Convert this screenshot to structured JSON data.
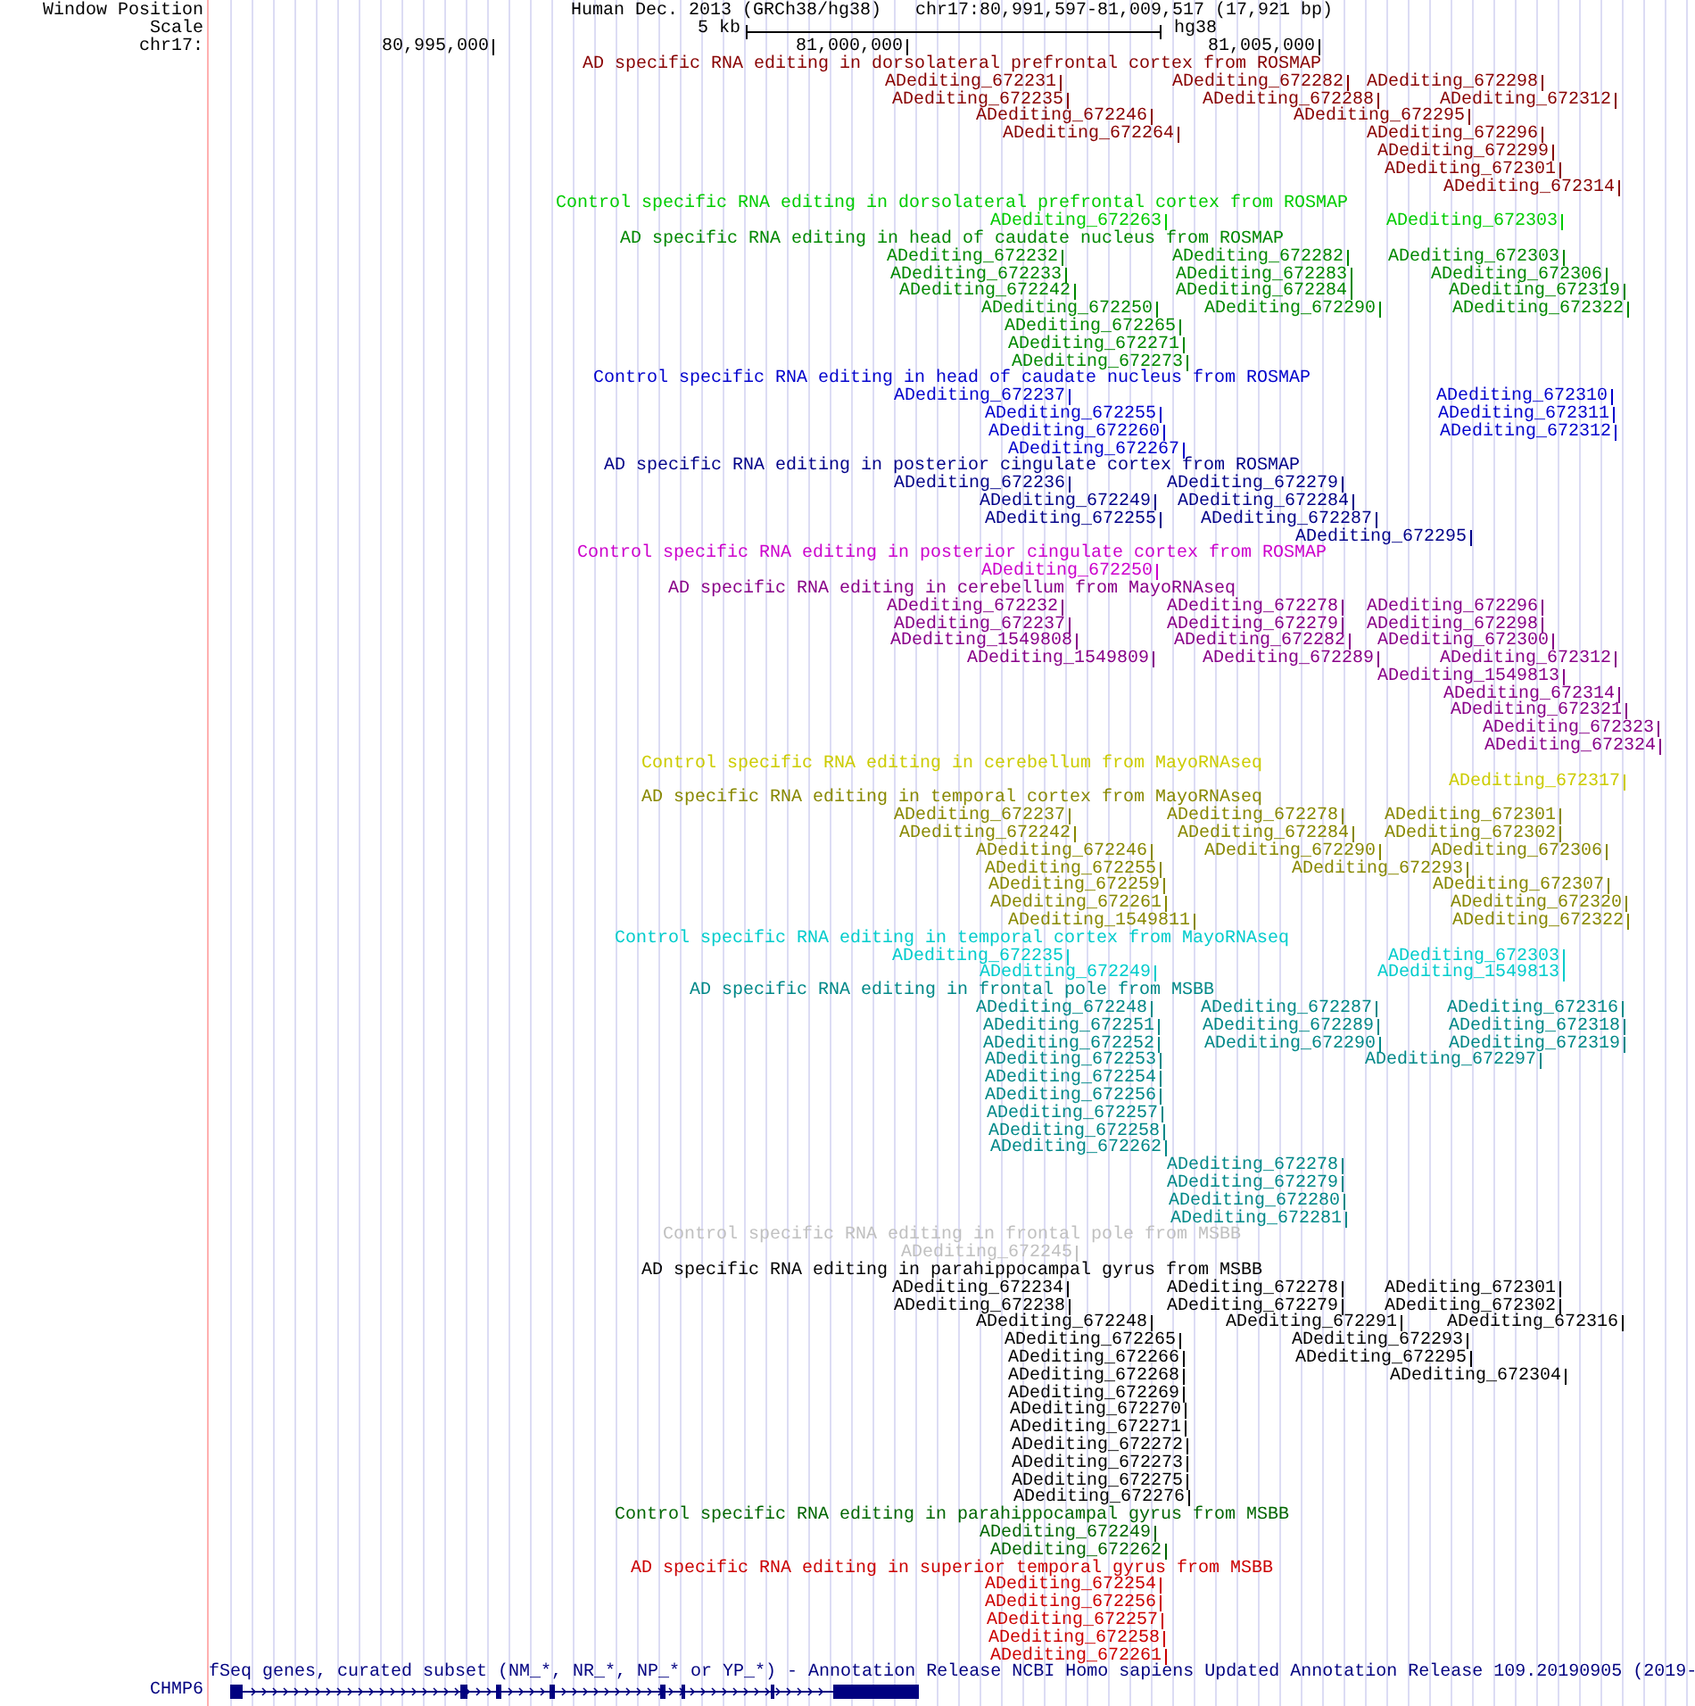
{
  "header": {
    "position_label": "Window Position",
    "assembly": "Human Dec. 2013 (GRCh38/hg38)",
    "region": "chr17:80,991,597-81,009,517 (17,921 bp)",
    "scale_label": "Scale",
    "scale_length": "5 kb",
    "scale_assembly": "hg38",
    "chrom_label": "chr17:",
    "ticks": [
      "80,995,000",
      "81,000,000",
      "81,005,000"
    ]
  },
  "tracks": [
    {
      "title": "AD specific RNA editing in dorsolateral prefrontal cortex from ROSMAP",
      "color": "#880000",
      "rows": [
        [
          "ADediting_672231",
          "ADediting_672282",
          "ADediting_672298"
        ],
        [
          "ADediting_672235",
          "ADediting_672288",
          "ADediting_672312"
        ],
        [
          "ADediting_672246",
          "ADediting_672295"
        ],
        [
          "ADediting_672264",
          "ADediting_672296"
        ],
        [
          "ADediting_672299"
        ],
        [
          "ADediting_672301"
        ],
        [
          "ADediting_672314"
        ]
      ]
    },
    {
      "title": "Control specific RNA editing in dorsolateral prefrontal cortex from ROSMAP",
      "color": "#00cc00",
      "rows": [
        [
          "ADediting_672263",
          "ADediting_672303"
        ]
      ]
    },
    {
      "title": "AD specific RNA editing in head of caudate nucleus from ROSMAP",
      "color": "#008800",
      "rows": [
        [
          "ADediting_672232",
          "ADediting_672282",
          "ADediting_672303"
        ],
        [
          "ADediting_672233",
          "ADediting_672283",
          "ADediting_672306"
        ],
        [
          "ADediting_672242",
          "ADediting_672284",
          "ADediting_672319"
        ],
        [
          "ADediting_672250",
          "ADediting_672290",
          "ADediting_672322"
        ],
        [
          "ADediting_672265"
        ],
        [
          "ADediting_672271"
        ],
        [
          "ADediting_672273"
        ]
      ]
    },
    {
      "title": "Control specific RNA editing in head of caudate nucleus from ROSMAP",
      "color": "#0000cc",
      "rows": [
        [
          "ADediting_672237",
          "ADediting_672310"
        ],
        [
          "ADediting_672255",
          "ADediting_672311"
        ],
        [
          "ADediting_672260",
          "ADediting_672312"
        ],
        [
          "ADediting_672267"
        ]
      ]
    },
    {
      "title": "AD specific RNA editing in posterior cingulate cortex from ROSMAP",
      "color": "#000088",
      "rows": [
        [
          "ADediting_672236",
          "ADediting_672279"
        ],
        [
          "ADediting_672249",
          "ADediting_672284"
        ],
        [
          "ADediting_672255",
          "ADediting_672287"
        ],
        [
          "ADediting_672295"
        ]
      ]
    },
    {
      "title": "Control specific RNA editing in posterior cingulate cortex from ROSMAP",
      "color": "#cc00cc",
      "rows": [
        [
          "ADediting_672250"
        ]
      ]
    },
    {
      "title": "AD specific RNA editing in cerebellum from MayoRNAseq",
      "color": "#880088",
      "rows": [
        [
          "ADediting_672232",
          "ADediting_672278",
          "ADediting_672296"
        ],
        [
          "ADediting_672237",
          "ADediting_672279",
          "ADediting_672298"
        ],
        [
          "ADediting_1549808",
          "ADediting_672282",
          "ADediting_672300"
        ],
        [
          "ADediting_1549809",
          "ADediting_672289",
          "ADediting_672312"
        ],
        [
          "ADediting_1549813"
        ],
        [
          "ADediting_672314"
        ],
        [
          "ADediting_672321"
        ],
        [
          "ADediting_672323"
        ],
        [
          "ADediting_672324"
        ]
      ]
    },
    {
      "title": "Control specific RNA editing in cerebellum from MayoRNAseq",
      "color": "#cccc00",
      "rows": [
        [
          "ADediting_672317"
        ]
      ]
    },
    {
      "title": "AD specific RNA editing in temporal cortex from MayoRNAseq",
      "color": "#888800",
      "rows": [
        [
          "ADediting_672237",
          "ADediting_672278",
          "ADediting_672301"
        ],
        [
          "ADediting_672242",
          "ADediting_672284",
          "ADediting_672302"
        ],
        [
          "ADediting_672246",
          "ADediting_672290",
          "ADediting_672306"
        ],
        [
          "ADediting_672255",
          "ADediting_672293"
        ],
        [
          "ADediting_672259",
          "ADediting_672307"
        ],
        [
          "ADediting_672261",
          "ADediting_672320"
        ],
        [
          "ADediting_1549811",
          "ADediting_672322"
        ]
      ]
    },
    {
      "title": "Control specific RNA editing in temporal cortex from MayoRNAseq",
      "color": "#00cccc",
      "rows": [
        [
          "ADediting_672235",
          "ADediting_672303"
        ],
        [
          "ADediting_672249",
          "ADediting_1549813"
        ]
      ]
    },
    {
      "title": "AD specific RNA editing in frontal pole from MSBB",
      "color": "#008888",
      "rows": [
        [
          "ADediting_672248",
          "ADediting_672287",
          "ADediting_672316"
        ],
        [
          "ADediting_672251",
          "ADediting_672289",
          "ADediting_672318"
        ],
        [
          "ADediting_672252",
          "ADediting_672290",
          "ADediting_672319"
        ],
        [
          "ADediting_672253",
          "ADediting_672297"
        ],
        [
          "ADediting_672254"
        ],
        [
          "ADediting_672256"
        ],
        [
          "ADediting_672257"
        ],
        [
          "ADediting_672258"
        ],
        [
          "ADediting_672262"
        ],
        [
          "ADediting_672278"
        ],
        [
          "ADediting_672279"
        ],
        [
          "ADediting_672280"
        ],
        [
          "ADediting_672281"
        ]
      ]
    },
    {
      "title": "Control specific RNA editing in frontal pole from MSBB",
      "color": "#c0c0c0",
      "rows": [
        [
          "ADediting_672245"
        ]
      ]
    },
    {
      "title": "AD specific RNA editing in parahippocampal gyrus from MSBB",
      "color": "#000000",
      "rows": [
        [
          "ADediting_672234",
          "ADediting_672278",
          "ADediting_672301"
        ],
        [
          "ADediting_672238",
          "ADediting_672279",
          "ADediting_672302"
        ],
        [
          "ADediting_672248",
          "ADediting_672291",
          "ADediting_672316"
        ],
        [
          "ADediting_672265",
          "ADediting_672293"
        ],
        [
          "ADediting_672266",
          "ADediting_672295"
        ],
        [
          "ADediting_672268",
          "ADediting_672304"
        ],
        [
          "ADediting_672269"
        ],
        [
          "ADediting_672270"
        ],
        [
          "ADediting_672271"
        ],
        [
          "ADediting_672272"
        ],
        [
          "ADediting_672273"
        ],
        [
          "ADediting_672275"
        ],
        [
          "ADediting_672276"
        ]
      ]
    },
    {
      "title": "Control specific RNA editing in parahippocampal gyrus from MSBB",
      "color": "#006600",
      "rows": [
        [
          "ADediting_672249"
        ],
        [
          "ADediting_672262"
        ]
      ]
    },
    {
      "title": "AD specific RNA editing in superior temporal gyrus from MSBB",
      "color": "#cc0000",
      "rows": [
        [
          "ADediting_672254"
        ],
        [
          "ADediting_672256"
        ],
        [
          "ADediting_672257"
        ],
        [
          "ADediting_672258"
        ],
        [
          "ADediting_672261"
        ]
      ]
    }
  ],
  "gene_track": {
    "title": "fSeq genes, curated subset (NM_*, NR_*, NP_* or YP_*) - Annotation Release NCBI Homo sapiens Updated Annotation Release 109.20190905 (2019-",
    "gene": "CHMP6"
  }
}
